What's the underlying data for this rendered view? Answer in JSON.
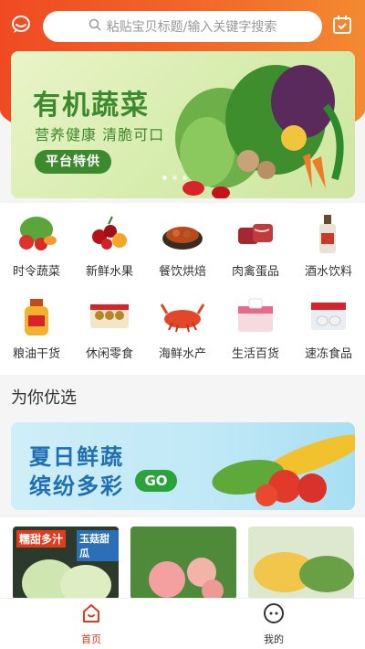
{
  "colors": {
    "brand": "#f04a23",
    "accent_green": "#3d8a2e",
    "promo_blue": "#1e6fb3"
  },
  "header": {
    "left_icon": "chat-bubble-icon",
    "right_icon": "calendar-check-icon",
    "search": {
      "placeholder": "粘贴宝贝标题/输入关键字搜索",
      "icon": "search-icon"
    }
  },
  "banner": {
    "title": "有机蔬菜",
    "subtitle": "营养健康 清脆可口",
    "button_label": "平台特供",
    "dots_count": 3,
    "active_dot": 1
  },
  "categories": [
    {
      "label": "时令蔬菜",
      "icon": "vegetables-icon"
    },
    {
      "label": "新鲜水果",
      "icon": "fruits-icon"
    },
    {
      "label": "餐饮烘焙",
      "icon": "food-icon"
    },
    {
      "label": "肉禽蛋品",
      "icon": "meat-icon"
    },
    {
      "label": "酒水饮料",
      "icon": "drinks-icon"
    },
    {
      "label": "粮油干货",
      "icon": "oil-icon"
    },
    {
      "label": "休闲零食",
      "icon": "snacks-icon"
    },
    {
      "label": "海鲜水产",
      "icon": "seafood-icon"
    },
    {
      "label": "生活百货",
      "icon": "daily-goods-icon"
    },
    {
      "label": "速冻食品",
      "icon": "frozen-food-icon"
    }
  ],
  "section": {
    "title": "为你优选"
  },
  "promo": {
    "line1": "夏日鲜蔬",
    "line2": "缤纷多彩",
    "go_label": "GO"
  },
  "products": [
    {
      "tag1": "糯甜多汁",
      "tag2": "玉菇甜瓜"
    },
    {},
    {}
  ],
  "tabbar": [
    {
      "label": "首页",
      "icon": "home-icon",
      "active": true
    },
    {
      "label": "我的",
      "icon": "profile-icon",
      "active": false
    }
  ]
}
